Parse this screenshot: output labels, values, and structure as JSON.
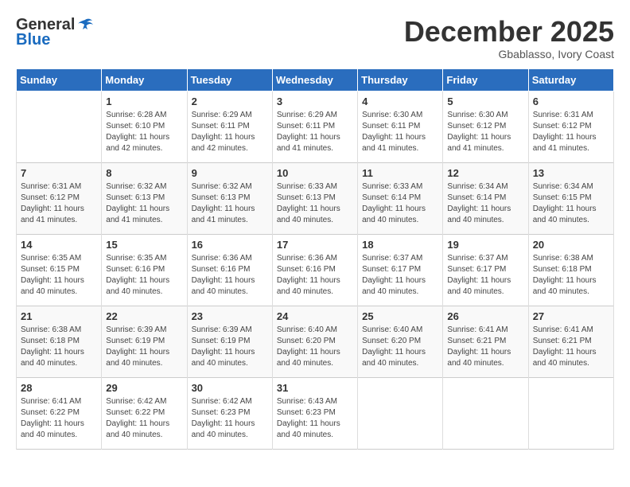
{
  "header": {
    "logo": {
      "general": "General",
      "blue": "Blue"
    },
    "title": "December 2025",
    "location": "Gbablasso, Ivory Coast"
  },
  "calendar": {
    "days_of_week": [
      "Sunday",
      "Monday",
      "Tuesday",
      "Wednesday",
      "Thursday",
      "Friday",
      "Saturday"
    ],
    "weeks": [
      [
        {
          "day": "",
          "sunrise": "",
          "sunset": "",
          "daylight": ""
        },
        {
          "day": "1",
          "sunrise": "Sunrise: 6:28 AM",
          "sunset": "Sunset: 6:10 PM",
          "daylight": "Daylight: 11 hours and 42 minutes."
        },
        {
          "day": "2",
          "sunrise": "Sunrise: 6:29 AM",
          "sunset": "Sunset: 6:11 PM",
          "daylight": "Daylight: 11 hours and 42 minutes."
        },
        {
          "day": "3",
          "sunrise": "Sunrise: 6:29 AM",
          "sunset": "Sunset: 6:11 PM",
          "daylight": "Daylight: 11 hours and 41 minutes."
        },
        {
          "day": "4",
          "sunrise": "Sunrise: 6:30 AM",
          "sunset": "Sunset: 6:11 PM",
          "daylight": "Daylight: 11 hours and 41 minutes."
        },
        {
          "day": "5",
          "sunrise": "Sunrise: 6:30 AM",
          "sunset": "Sunset: 6:12 PM",
          "daylight": "Daylight: 11 hours and 41 minutes."
        },
        {
          "day": "6",
          "sunrise": "Sunrise: 6:31 AM",
          "sunset": "Sunset: 6:12 PM",
          "daylight": "Daylight: 11 hours and 41 minutes."
        }
      ],
      [
        {
          "day": "7",
          "sunrise": "Sunrise: 6:31 AM",
          "sunset": "Sunset: 6:12 PM",
          "daylight": "Daylight: 11 hours and 41 minutes."
        },
        {
          "day": "8",
          "sunrise": "Sunrise: 6:32 AM",
          "sunset": "Sunset: 6:13 PM",
          "daylight": "Daylight: 11 hours and 41 minutes."
        },
        {
          "day": "9",
          "sunrise": "Sunrise: 6:32 AM",
          "sunset": "Sunset: 6:13 PM",
          "daylight": "Daylight: 11 hours and 41 minutes."
        },
        {
          "day": "10",
          "sunrise": "Sunrise: 6:33 AM",
          "sunset": "Sunset: 6:13 PM",
          "daylight": "Daylight: 11 hours and 40 minutes."
        },
        {
          "day": "11",
          "sunrise": "Sunrise: 6:33 AM",
          "sunset": "Sunset: 6:14 PM",
          "daylight": "Daylight: 11 hours and 40 minutes."
        },
        {
          "day": "12",
          "sunrise": "Sunrise: 6:34 AM",
          "sunset": "Sunset: 6:14 PM",
          "daylight": "Daylight: 11 hours and 40 minutes."
        },
        {
          "day": "13",
          "sunrise": "Sunrise: 6:34 AM",
          "sunset": "Sunset: 6:15 PM",
          "daylight": "Daylight: 11 hours and 40 minutes."
        }
      ],
      [
        {
          "day": "14",
          "sunrise": "Sunrise: 6:35 AM",
          "sunset": "Sunset: 6:15 PM",
          "daylight": "Daylight: 11 hours and 40 minutes."
        },
        {
          "day": "15",
          "sunrise": "Sunrise: 6:35 AM",
          "sunset": "Sunset: 6:16 PM",
          "daylight": "Daylight: 11 hours and 40 minutes."
        },
        {
          "day": "16",
          "sunrise": "Sunrise: 6:36 AM",
          "sunset": "Sunset: 6:16 PM",
          "daylight": "Daylight: 11 hours and 40 minutes."
        },
        {
          "day": "17",
          "sunrise": "Sunrise: 6:36 AM",
          "sunset": "Sunset: 6:16 PM",
          "daylight": "Daylight: 11 hours and 40 minutes."
        },
        {
          "day": "18",
          "sunrise": "Sunrise: 6:37 AM",
          "sunset": "Sunset: 6:17 PM",
          "daylight": "Daylight: 11 hours and 40 minutes."
        },
        {
          "day": "19",
          "sunrise": "Sunrise: 6:37 AM",
          "sunset": "Sunset: 6:17 PM",
          "daylight": "Daylight: 11 hours and 40 minutes."
        },
        {
          "day": "20",
          "sunrise": "Sunrise: 6:38 AM",
          "sunset": "Sunset: 6:18 PM",
          "daylight": "Daylight: 11 hours and 40 minutes."
        }
      ],
      [
        {
          "day": "21",
          "sunrise": "Sunrise: 6:38 AM",
          "sunset": "Sunset: 6:18 PM",
          "daylight": "Daylight: 11 hours and 40 minutes."
        },
        {
          "day": "22",
          "sunrise": "Sunrise: 6:39 AM",
          "sunset": "Sunset: 6:19 PM",
          "daylight": "Daylight: 11 hours and 40 minutes."
        },
        {
          "day": "23",
          "sunrise": "Sunrise: 6:39 AM",
          "sunset": "Sunset: 6:19 PM",
          "daylight": "Daylight: 11 hours and 40 minutes."
        },
        {
          "day": "24",
          "sunrise": "Sunrise: 6:40 AM",
          "sunset": "Sunset: 6:20 PM",
          "daylight": "Daylight: 11 hours and 40 minutes."
        },
        {
          "day": "25",
          "sunrise": "Sunrise: 6:40 AM",
          "sunset": "Sunset: 6:20 PM",
          "daylight": "Daylight: 11 hours and 40 minutes."
        },
        {
          "day": "26",
          "sunrise": "Sunrise: 6:41 AM",
          "sunset": "Sunset: 6:21 PM",
          "daylight": "Daylight: 11 hours and 40 minutes."
        },
        {
          "day": "27",
          "sunrise": "Sunrise: 6:41 AM",
          "sunset": "Sunset: 6:21 PM",
          "daylight": "Daylight: 11 hours and 40 minutes."
        }
      ],
      [
        {
          "day": "28",
          "sunrise": "Sunrise: 6:41 AM",
          "sunset": "Sunset: 6:22 PM",
          "daylight": "Daylight: 11 hours and 40 minutes."
        },
        {
          "day": "29",
          "sunrise": "Sunrise: 6:42 AM",
          "sunset": "Sunset: 6:22 PM",
          "daylight": "Daylight: 11 hours and 40 minutes."
        },
        {
          "day": "30",
          "sunrise": "Sunrise: 6:42 AM",
          "sunset": "Sunset: 6:23 PM",
          "daylight": "Daylight: 11 hours and 40 minutes."
        },
        {
          "day": "31",
          "sunrise": "Sunrise: 6:43 AM",
          "sunset": "Sunset: 6:23 PM",
          "daylight": "Daylight: 11 hours and 40 minutes."
        },
        {
          "day": "",
          "sunrise": "",
          "sunset": "",
          "daylight": ""
        },
        {
          "day": "",
          "sunrise": "",
          "sunset": "",
          "daylight": ""
        },
        {
          "day": "",
          "sunrise": "",
          "sunset": "",
          "daylight": ""
        }
      ]
    ]
  }
}
